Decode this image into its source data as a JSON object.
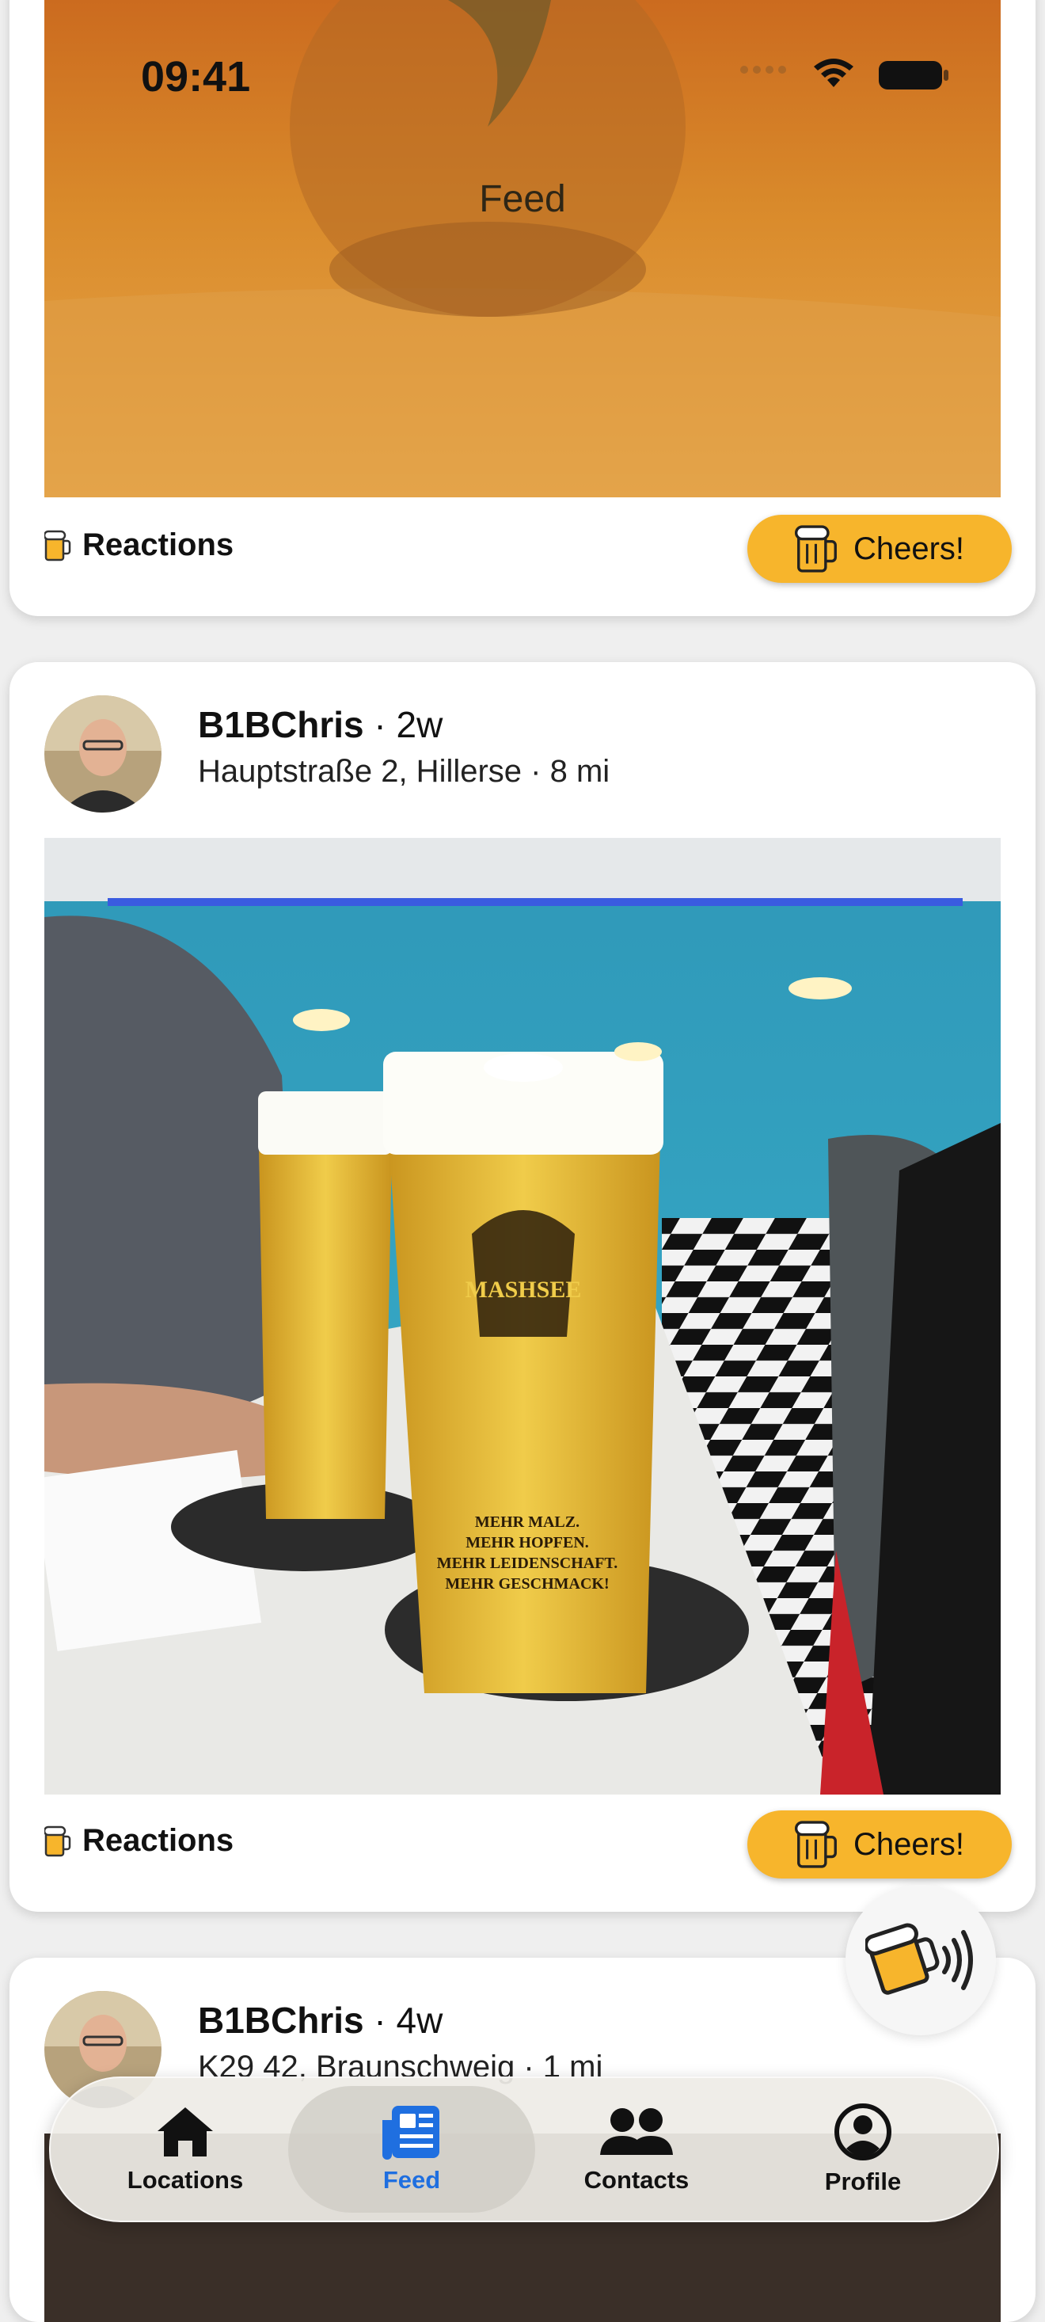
{
  "status_bar": {
    "time": "09:41"
  },
  "header": {
    "title": "Feed"
  },
  "posts": [
    {
      "reactions_label": "Reactions",
      "cheers_label": "Cheers!"
    },
    {
      "username": "B1BChris",
      "time_ago": "· 2w",
      "location": "Hauptstraße 2, Hillerse · 8 mi",
      "reactions_label": "Reactions",
      "cheers_label": "Cheers!"
    },
    {
      "username": "B1BChris",
      "time_ago": "· 4w",
      "location": "K29 42, Braunschweig · 1 mi"
    }
  ],
  "glass_print": {
    "brand": "MASHSEE",
    "slogan": [
      "MEHR MALZ.",
      "MEHR HOPFEN.",
      "MEHR LEIDENSCHAFT.",
      "MEHR GESCHMACK!"
    ]
  },
  "tabbar": {
    "tabs": [
      {
        "label": "Locations",
        "icon": "house-icon"
      },
      {
        "label": "Feed",
        "icon": "newspaper-icon",
        "active": true
      },
      {
        "label": "Contacts",
        "icon": "people-icon"
      },
      {
        "label": "Profile",
        "icon": "person-circle-icon"
      }
    ]
  },
  "colors": {
    "accent": "#f7b52c",
    "active_tab": "#1f6fe0",
    "background": "#efefef"
  }
}
